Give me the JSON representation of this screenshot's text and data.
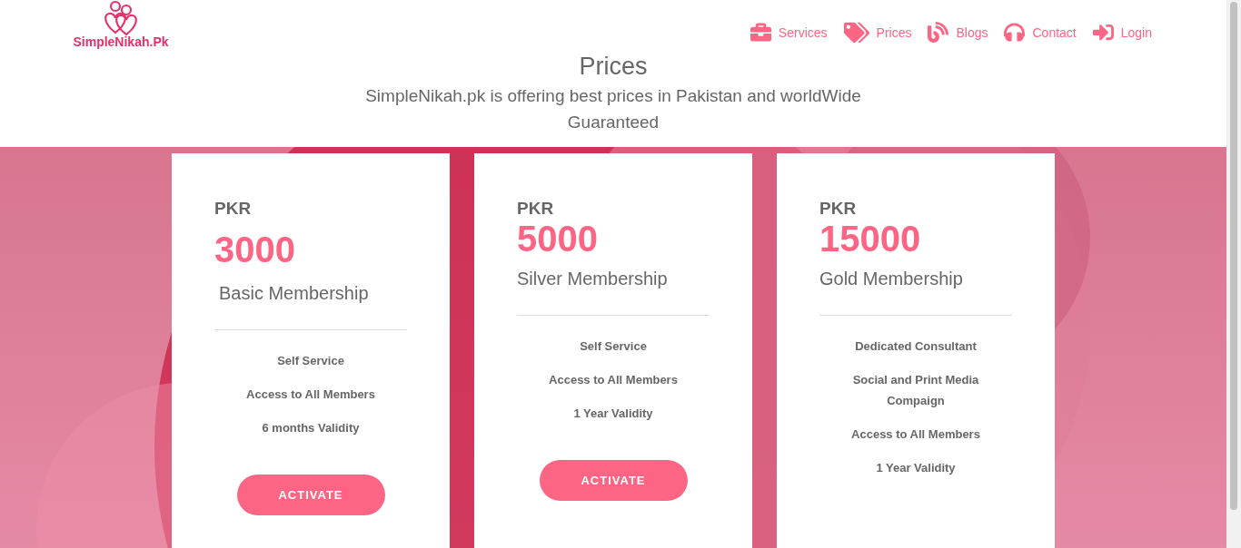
{
  "logo": {
    "text": "SimpleNikah.Pk"
  },
  "nav": [
    {
      "label": "Services",
      "selected": false
    },
    {
      "label": "Prices",
      "selected": false
    },
    {
      "label": "Blogs",
      "selected": false
    },
    {
      "label": "Contact",
      "selected": false
    },
    {
      "label": "Login",
      "selected": false
    }
  ],
  "hero": {
    "title": "Prices",
    "subtitle": "SimpleNikah.pk is offering best prices in Pakistan and worldWide Guaranteed"
  },
  "plans": [
    {
      "currency": "PKR",
      "price": "3000",
      "name": "Basic Membership",
      "features": [
        "Self Service",
        "Access to All Members",
        "6 months Validity"
      ],
      "button": "ACTIVATE"
    },
    {
      "currency": "PKR",
      "price": "5000",
      "name": "Silver Membership",
      "features": [
        "Self Service",
        "Access to All Members",
        "1 Year Validity"
      ],
      "button": "ACTIVATE"
    },
    {
      "currency": "PKR",
      "price": "15000",
      "name": "Gold Membership",
      "features": [
        "Dedicated Consultant",
        "Social and Print Media Compaign",
        "Access to All Members",
        "1 Year Validity"
      ]
    }
  ]
}
